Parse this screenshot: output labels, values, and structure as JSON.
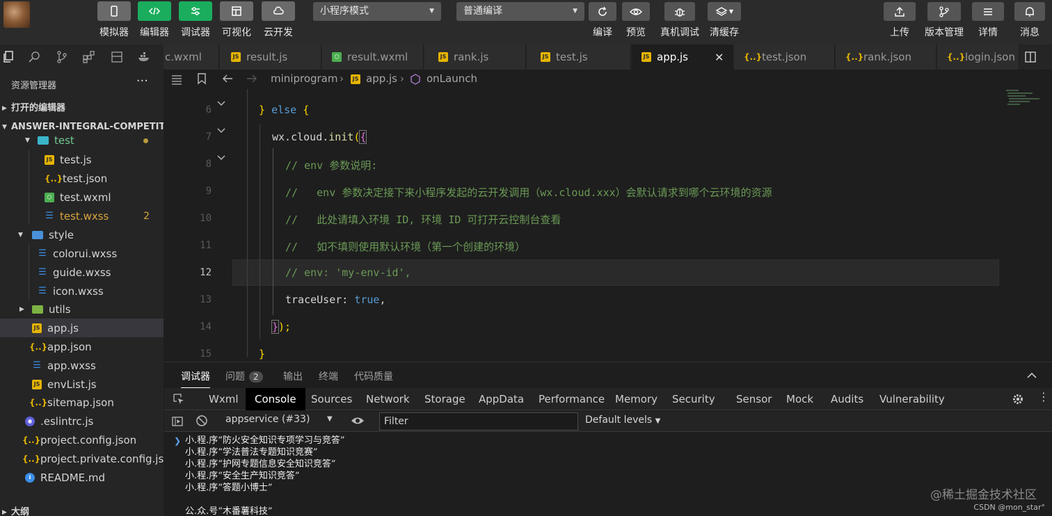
{
  "toolbar": {
    "simulator": "模拟器",
    "editor": "编辑器",
    "debugger": "调试器",
    "visual": "可视化",
    "cloud": "云开发",
    "mode_select": "小程序模式",
    "compile_select": "普通编译",
    "compile": "编译",
    "preview": "预览",
    "real_debug": "真机调试",
    "clear_cache": "清缓存",
    "upload": "上传",
    "version": "版本管理",
    "details": "详情",
    "messages": "消息"
  },
  "tabs": [
    {
      "label": "c.wxml"
    },
    {
      "label": "result.js"
    },
    {
      "label": "result.wxml"
    },
    {
      "label": "rank.js"
    },
    {
      "label": "test.js"
    },
    {
      "label": "app.js"
    },
    {
      "label": "test.json"
    },
    {
      "label": "rank.json"
    },
    {
      "label": "login.json"
    }
  ],
  "sidebar": {
    "title": "资源管理器",
    "more": "···",
    "open_editors": "打开的编辑器",
    "project": "ANSWER-INTEGRAL-COMPETITI...",
    "outline": "大纲",
    "items": [
      {
        "label": "test"
      },
      {
        "label": "test.js"
      },
      {
        "label": "test.json"
      },
      {
        "label": "test.wxml"
      },
      {
        "label": "test.wxss",
        "badge": "2"
      },
      {
        "label": "style"
      },
      {
        "label": "colorui.wxss"
      },
      {
        "label": "guide.wxss"
      },
      {
        "label": "icon.wxss"
      },
      {
        "label": "utils"
      },
      {
        "label": "app.js"
      },
      {
        "label": "app.json"
      },
      {
        "label": "app.wxss"
      },
      {
        "label": "envList.js"
      },
      {
        "label": "sitemap.json"
      },
      {
        "label": ".eslintrc.js"
      },
      {
        "label": "project.config.json"
      },
      {
        "label": "project.private.config.js..."
      },
      {
        "label": "README.md"
      }
    ]
  },
  "breadcrumb": {
    "folder": "miniprogram",
    "file": "app.js",
    "symbol": "onLaunch"
  },
  "editor": {
    "current_line": "12",
    "lines": [
      {
        "num": "6",
        "parts": [
          "} ",
          "else",
          " {"
        ]
      },
      {
        "num": "7",
        "parts": [
          "wx.cloud.",
          "init",
          "(",
          "{"
        ]
      },
      {
        "num": "8",
        "text": "// env 参数说明:"
      },
      {
        "num": "9",
        "text": "//   env 参数决定接下来小程序发起的云开发调用（wx.cloud.xxx）会默认请求到哪个云环境的资源"
      },
      {
        "num": "10",
        "text": "//   此处请填入环境 ID, 环境 ID 可打开云控制台查看"
      },
      {
        "num": "11",
        "text": "//   如不填则使用默认环境（第一个创建的环境）"
      },
      {
        "num": "12",
        "text": "// env: 'my-env-id',"
      },
      {
        "num": "13",
        "parts": [
          "traceUser: ",
          "true",
          ","
        ]
      },
      {
        "num": "14",
        "parts": [
          "}",
          ");"
        ]
      },
      {
        "num": "15",
        "parts": [
          "}"
        ]
      }
    ]
  },
  "panel": {
    "tabs": [
      "调试器",
      "问题",
      "输出",
      "终端",
      "代码质量"
    ],
    "problems_count": "2",
    "devtools_tabs": [
      "Wxml",
      "Console",
      "Sources",
      "Network",
      "Storage",
      "AppData",
      "Performance",
      "Memory",
      "Security",
      "Sensor",
      "Mock",
      "Audits",
      "Vulnerability"
    ],
    "context": "appservice (#33)",
    "filter_placeholder": "Filter",
    "levels": "Default levels",
    "logs": [
      "小.程.序“防火安全知识专项学习与竞答”",
      "小.程.序“学法普法专题知识竞赛”",
      "小.程.序“护网专题信息安全知识竞答”",
      "小.程.序“安全生产知识竞答”",
      "小.程.序“答题小博士”",
      "公.众.号“木番薯科技”"
    ],
    "watermark": "@稀土掘金技术社区",
    "credit": "CSDN @mon_star°"
  }
}
